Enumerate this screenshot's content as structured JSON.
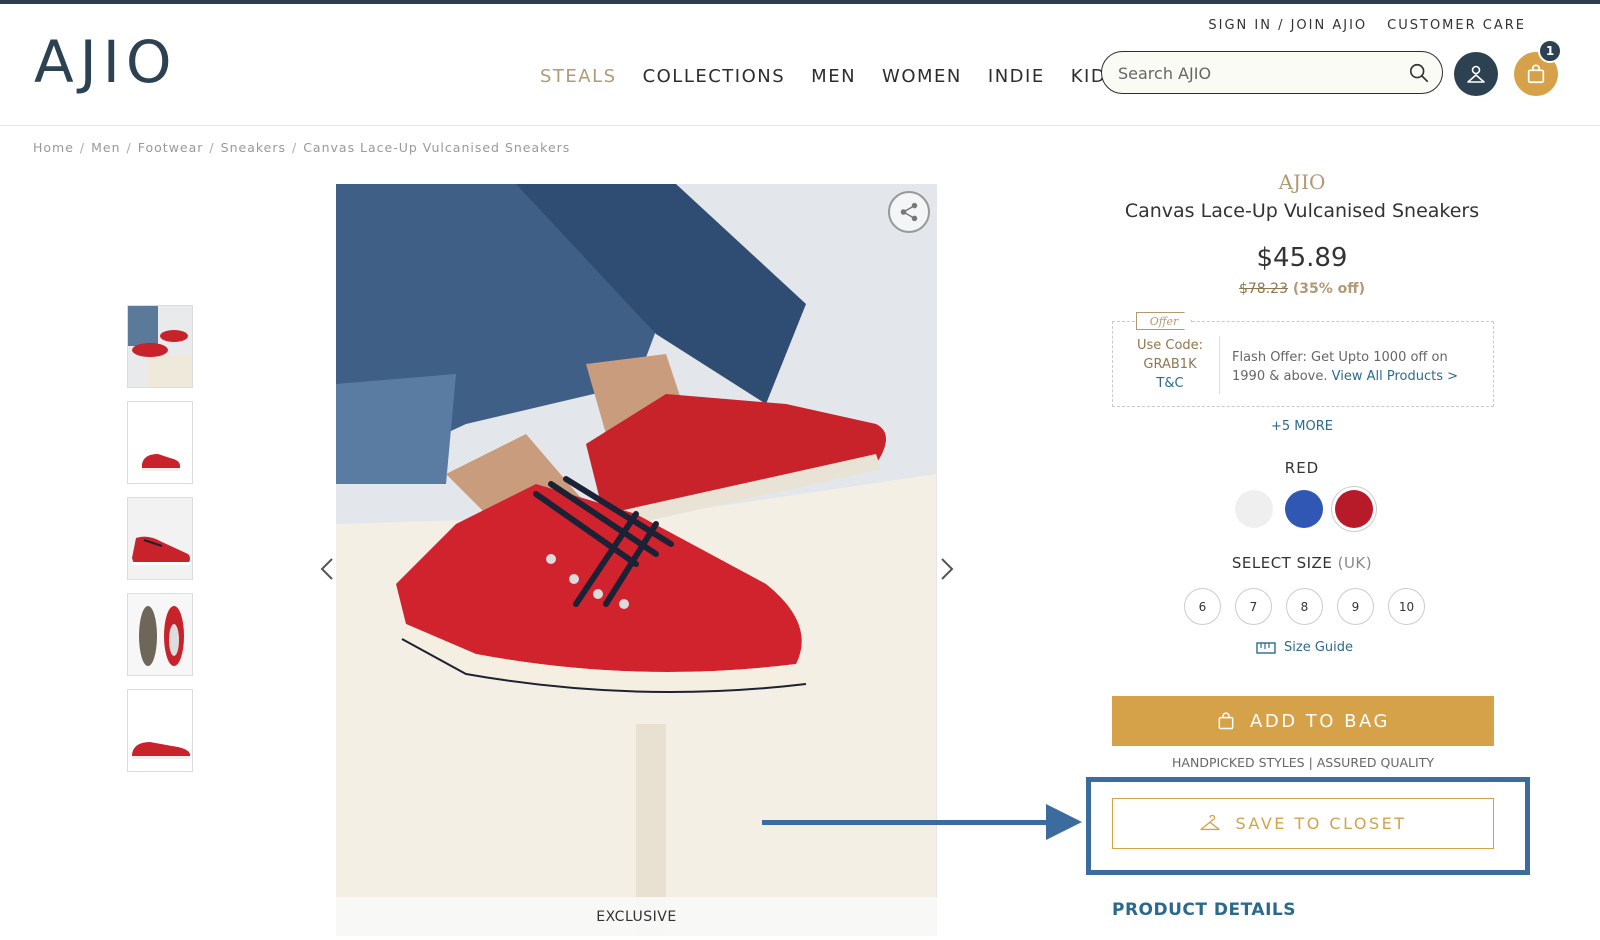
{
  "header": {
    "logo": "AJIO",
    "top_links": [
      "SIGN IN / JOIN AJIO",
      "CUSTOMER CARE"
    ],
    "nav": [
      "STEALS",
      "COLLECTIONS",
      "MEN",
      "WOMEN",
      "INDIE",
      "KIDS"
    ],
    "search_placeholder": "Search AJIO",
    "bag_count": "1",
    "icons": {
      "search": "search-icon",
      "user": "user-icon",
      "bag": "shopping-bag-icon"
    }
  },
  "breadcrumb": [
    "Home",
    "Men",
    "Footwear",
    "Sneakers",
    "Canvas Lace-Up Vulcanised Sneakers"
  ],
  "gallery": {
    "thumbnail_count": 5,
    "badge": "EXCLUSIVE"
  },
  "product": {
    "brand": "AJIO",
    "name": "Canvas Lace-Up Vulcanised Sneakers",
    "price": "$45.89",
    "mrp": "$78.23",
    "discount": "(35% off)",
    "offer": {
      "tag": "Offer",
      "use_code_label": "Use Code:",
      "code": "GRAB1K",
      "tc": "T&C",
      "text": "Flash Offer: Get Upto 1000 off on 1990 & above.",
      "link": "View All Products >"
    },
    "more_offers": "+5 MORE",
    "color_label": "RED",
    "colors": [
      "#efefef",
      "#2f57b3",
      "#b71b29"
    ],
    "size_label": "SELECT SIZE",
    "size_unit": "(UK)",
    "sizes": [
      "6",
      "7",
      "8",
      "9",
      "10"
    ],
    "size_guide": "Size Guide",
    "add_to_bag": "ADD TO BAG",
    "handpicked": "HANDPICKED STYLES | ASSURED QUALITY",
    "save_to_closet": "SAVE TO CLOSET",
    "product_details": "PRODUCT DETAILS"
  },
  "colors": {
    "brand_gold": "#d5a249",
    "dark_navy": "#2c4152",
    "highlight": "#3c6b9e"
  }
}
